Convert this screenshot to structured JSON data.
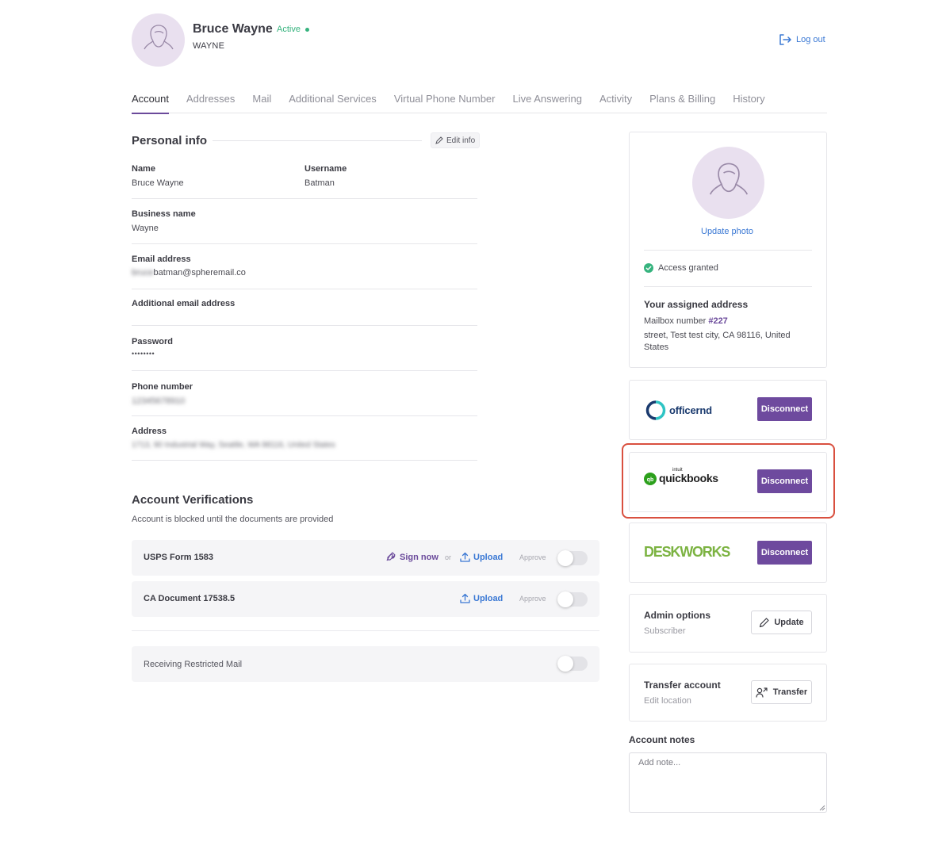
{
  "header": {
    "user_name": "Bruce Wayne",
    "status": "Active",
    "company": "WAYNE",
    "logout_label": "Log out"
  },
  "tabs": [
    {
      "label": "Account",
      "active": true
    },
    {
      "label": "Addresses"
    },
    {
      "label": "Mail"
    },
    {
      "label": "Additional Services"
    },
    {
      "label": "Virtual Phone Number"
    },
    {
      "label": "Live Answering"
    },
    {
      "label": "Activity"
    },
    {
      "label": "Plans & Billing"
    },
    {
      "label": "History"
    }
  ],
  "personal_info": {
    "title": "Personal info",
    "edit_label": "Edit info",
    "name_label": "Name",
    "name_value": "Bruce Wayne",
    "username_label": "Username",
    "username_value": "Batman",
    "business_label": "Business name",
    "business_value": "Wayne",
    "email_label": "Email address",
    "email_value_blurred": "bruce",
    "email_value": "batman@spheremail.co",
    "additional_email_label": "Additional email address",
    "password_label": "Password",
    "password_value": "••••••••",
    "phone_label": "Phone number",
    "phone_value_blurred": "12345678910",
    "address_label": "Address",
    "address_value_blurred": "1713, 90 Industrial Way, Seattle, WA 98116, United States"
  },
  "verifications": {
    "title": "Account Verifications",
    "subtitle": "Account is blocked until the documents are provided",
    "rows": [
      {
        "name": "USPS Form 1583",
        "sign_label": "Sign now",
        "or_label": "or",
        "upload_label": "Upload",
        "approve_label": "Approve",
        "approved": false
      },
      {
        "name": "CA Document 17538.5",
        "upload_label": "Upload",
        "approve_label": "Approve",
        "approved": false
      }
    ],
    "restricted_mail_label": "Receiving Restricted Mail",
    "restricted_mail_on": false
  },
  "profile_card": {
    "update_photo_label": "Update photo",
    "access_label": "Access granted",
    "assigned_title": "Your assigned address",
    "mailbox_prefix": "Mailbox number ",
    "mailbox_number": "#227",
    "address_text": "street, Test test city, CA 98116, United States"
  },
  "integrations": [
    {
      "name": "officernd",
      "button": "Disconnect"
    },
    {
      "name": "quickbooks",
      "tagline": "intuit",
      "button": "Disconnect"
    },
    {
      "name": "DESKWORKS",
      "button": "Disconnect"
    }
  ],
  "admin": {
    "title": "Admin options",
    "subtitle": "Subscriber",
    "button": "Update"
  },
  "transfer": {
    "title": "Transfer account",
    "subtitle": "Edit location",
    "button": "Transfer"
  },
  "notes": {
    "label": "Account notes",
    "placeholder": "Add note..."
  },
  "colors": {
    "accent": "#6e4a9e",
    "link": "#3a78d4",
    "success": "#36b37e",
    "highlight": "#d9503f",
    "quickbooks_green": "#2ca01c",
    "officernd_blue": "#1a3a6e",
    "officernd_teal": "#2ec4c4"
  }
}
